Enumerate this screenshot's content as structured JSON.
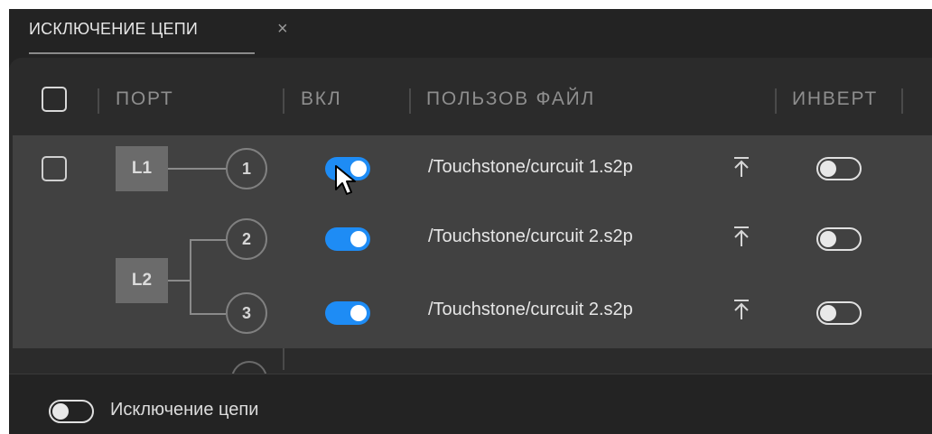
{
  "tab": {
    "title": "ИСКЛЮЧЕНИЕ ЦЕПИ",
    "close": "×"
  },
  "header": {
    "port": "ПОРТ",
    "on": "ВКЛ",
    "user_file": "ПОЛЬЗОВ ФАЙЛ",
    "invert": "ИНВЕРТ"
  },
  "rows": [
    {
      "group": "L1",
      "port": "1",
      "enabled": true,
      "file": "/Touchstone/curcuit 1.s2p",
      "invert": false
    },
    {
      "group": "L2",
      "port": "2",
      "enabled": true,
      "file": "/Touchstone/curcuit 2.s2p",
      "invert": false
    },
    {
      "group": "L2",
      "port": "3",
      "enabled": true,
      "file": "/Touchstone/curcuit 2.s2p",
      "invert": false
    }
  ],
  "footer": {
    "label": "Исключение цепи",
    "enabled": false
  },
  "icons": {
    "close": "close-icon",
    "upload": "upload-icon",
    "cursor": "mouse-pointer-icon"
  },
  "colors": {
    "toggle_on": "#1e8cf5",
    "background": "#232323",
    "row_bg": "#414141"
  }
}
